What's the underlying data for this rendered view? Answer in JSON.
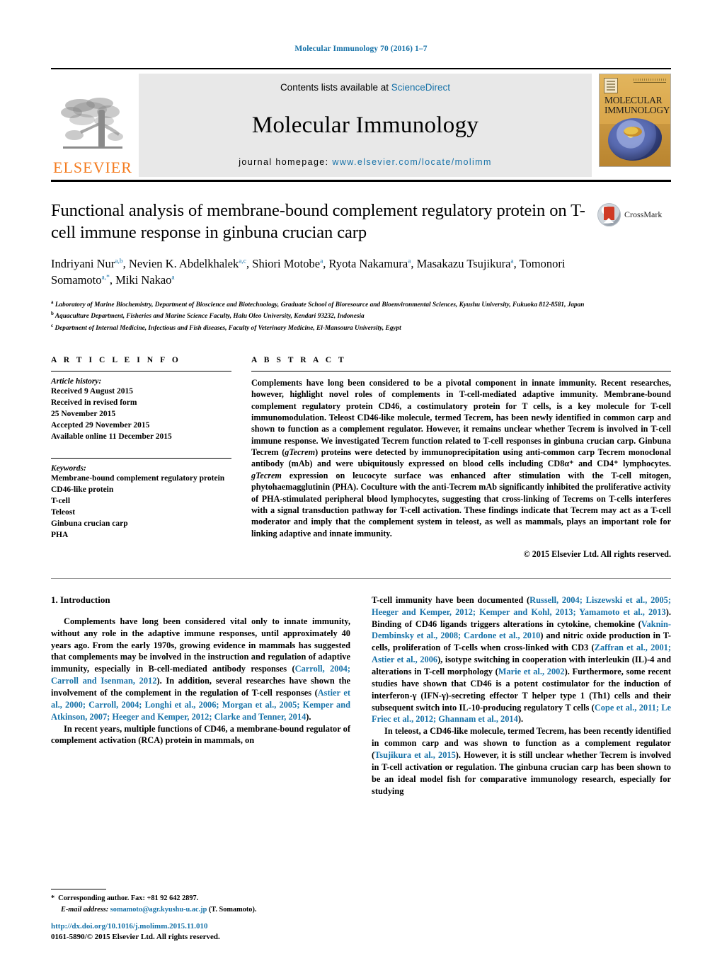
{
  "running_head": "Molecular Immunology 70 (2016) 1–7",
  "masthead": {
    "publisher_name": "ELSEVIER",
    "contents_prefix": "Contents lists available at ",
    "contents_link": "ScienceDirect",
    "journal_title": "Molecular Immunology",
    "homepage_label": "journal homepage: ",
    "homepage_url": "www.elsevier.com/locate/molimm",
    "cover_title_line1": "MOLECULAR",
    "cover_title_line2": "IMMUNOLOGY"
  },
  "article": {
    "title": "Functional analysis of membrane-bound complement regulatory protein on T-cell immune response in ginbuna crucian carp",
    "authors_line1_parts": [
      {
        "name": "Indriyani Nur",
        "sup": "a,b"
      },
      {
        "name": "Nevien K. Abdelkhalek",
        "sup": "a,c"
      },
      {
        "name": "Shiori Motobe",
        "sup": "a"
      },
      {
        "name": "Ryota Nakamura",
        "sup": "a"
      }
    ],
    "authors_line2_parts": [
      {
        "name": "Masakazu Tsujikura",
        "sup": "a"
      },
      {
        "name": "Tomonori Somamoto",
        "sup": "a,*"
      },
      {
        "name": "Miki Nakao",
        "sup": "a"
      }
    ],
    "affiliations": [
      {
        "mark": "a",
        "text": "Laboratory of Marine Biochemistry, Department of Bioscience and Biotechnology, Graduate School of Bioresource and Bioenvironmental Sciences, Kyushu University, Fukuoka 812-8581, Japan"
      },
      {
        "mark": "b",
        "text": "Aquaculture Department, Fisheries and Marine Science Faculty, Halu Oleo University, Kendari 93232, Indonesia"
      },
      {
        "mark": "c",
        "text": "Department of Internal Medicine, Infectious and Fish diseases, Faculty of Veterinary Medicine, El-Mansoura University, Egypt"
      }
    ],
    "crossmark_label": "CrossMark"
  },
  "article_info": {
    "heading": "A R T I C L E   I N F O",
    "history_label": "Article history:",
    "history": [
      "Received 9 August 2015",
      "Received in revised form",
      "25 November 2015",
      "Accepted 29 November 2015",
      "Available online 11 December 2015"
    ],
    "keywords_label": "Keywords:",
    "keywords": [
      "Membrane-bound complement regulatory protein",
      "CD46-like protein",
      "T-cell",
      "Teleost",
      "Ginbuna crucian carp",
      "PHA"
    ]
  },
  "abstract": {
    "heading": "A B S T R A C T",
    "text_part1": "Complements have long been considered to be a pivotal component in innate immunity. Recent researches, however, highlight novel roles of complements in T-cell-mediated adaptive immunity. Membrane-bound complement regulatory protein CD46, a costimulatory protein for T cells, is a key molecule for T-cell immunomodulation. Teleost CD46-like molecule, termed Tecrem, has been newly identified in common carp and shown to function as a complement regulator. However, it remains unclear whether Tecrem is involved in T-cell immune response. We investigated Tecrem function related to T-cell responses in ginbuna crucian carp. Ginbuna Tecrem (",
    "italic1": "gTecrem",
    "text_part2": ") proteins were detected by immunoprecipitation using anti-common carp Tecrem monoclonal antibody (mAb) and were ubiquitously expressed on blood cells including CD8α⁺ and CD4⁺ lymphocytes. ",
    "italic2": "gTecrem",
    "text_part3": " expression on leucocyte surface was enhanced after stimulation with the T-cell mitogen, phytohaemagglutinin (PHA). Coculture with the anti-Tecrem mAb significantly inhibited the proliferative activity of PHA-stimulated peripheral blood lymphocytes, suggesting that cross-linking of Tecrems on T-cells interferes with a signal transduction pathway for T-cell activation. These findings indicate that Tecrem may act as a T-cell moderator and imply that the complement system in teleost, as well as mammals, plays an important role for linking adaptive and innate immunity.",
    "copyright": "© 2015 Elsevier Ltd. All rights reserved."
  },
  "introduction": {
    "heading": "1.  Introduction",
    "left_p1_a": "Complements have long been considered vital only to innate immunity, without any role in the adaptive immune responses, until approximately 40 years ago. From the early 1970s, growing evidence in mammals has suggested that complements may be involved in the instruction and regulation of adaptive immunity, especially in B-cell-mediated antibody responses (",
    "left_p1_ref1": "Carroll, 2004; Carroll and Isenman, 2012",
    "left_p1_b": "). In addition, several researches have shown the involvement of the complement in the regulation of T-cell responses (",
    "left_p1_ref2": "Astier et al., 2000; Carroll, 2004; Longhi et al., 2006; Morgan et al., 2005; Kemper and Atkinson, 2007; Heeger and Kemper, 2012; Clarke and Tenner, 2014",
    "left_p1_c": ").",
    "left_p2": "In recent years, multiple functions of CD46, a membrane-bound regulator of complement activation (RCA) protein in mammals, on",
    "right_p1_a": "T-cell immunity have been documented (",
    "right_p1_ref1": "Russell, 2004; Liszewski et al., 2005; Heeger and Kemper, 2012; Kemper and Kohl, 2013; Yamamoto et al., 2013",
    "right_p1_b": "). Binding of CD46 ligands triggers alterations in cytokine, chemokine (",
    "right_p1_ref2": "Vaknin-Dembinsky et al., 2008; Cardone et al., 2010",
    "right_p1_c": ") and nitric oxide production in T-cells, proliferation of T-cells when cross-linked with CD3 (",
    "right_p1_ref3": "Zaffran et al., 2001; Astier et al., 2006",
    "right_p1_d": "), isotype switching in cooperation with interleukin (IL)-4 and alterations in T-cell morphology (",
    "right_p1_ref4": "Marie et al., 2002",
    "right_p1_e": "). Furthermore, some recent studies have shown that CD46 is a potent costimulator for the induction of interferon-γ (IFN-γ)-secreting effector T helper type 1 (Th1) cells and their subsequent switch into IL-10-producing regulatory T cells (",
    "right_p1_ref5": "Cope et al., 2011; Le Friec et al., 2012; Ghannam et al., 2014",
    "right_p1_f": ").",
    "right_p2_a": "In teleost, a CD46-like molecule, termed Tecrem, has been recently identified in common carp and was shown to function as a complement regulator (",
    "right_p2_ref1": "Tsujikura et al., 2015",
    "right_p2_b": "). However, it is still unclear whether Tecrem is involved in T-cell activation or regulation. The ginbuna crucian carp has been shown to be an ideal model fish for comparative immunology research, especially for studying"
  },
  "footnote": {
    "star": "*",
    "corresponding": "Corresponding author. Fax: +81 92 642 2897.",
    "email_label": "E-mail address:",
    "email": "somamoto@agr.kyushu-u.ac.jp",
    "email_suffix": "(T. Somamoto)."
  },
  "doi_block": {
    "doi_url": "http://dx.doi.org/10.1016/j.molimm.2015.11.010",
    "issn_line": "0161-5890/© 2015 Elsevier Ltd. All rights reserved."
  },
  "colors": {
    "link": "#1772a8",
    "elsevier_orange": "#f47c20",
    "band_gray": "#e8e8e8"
  }
}
